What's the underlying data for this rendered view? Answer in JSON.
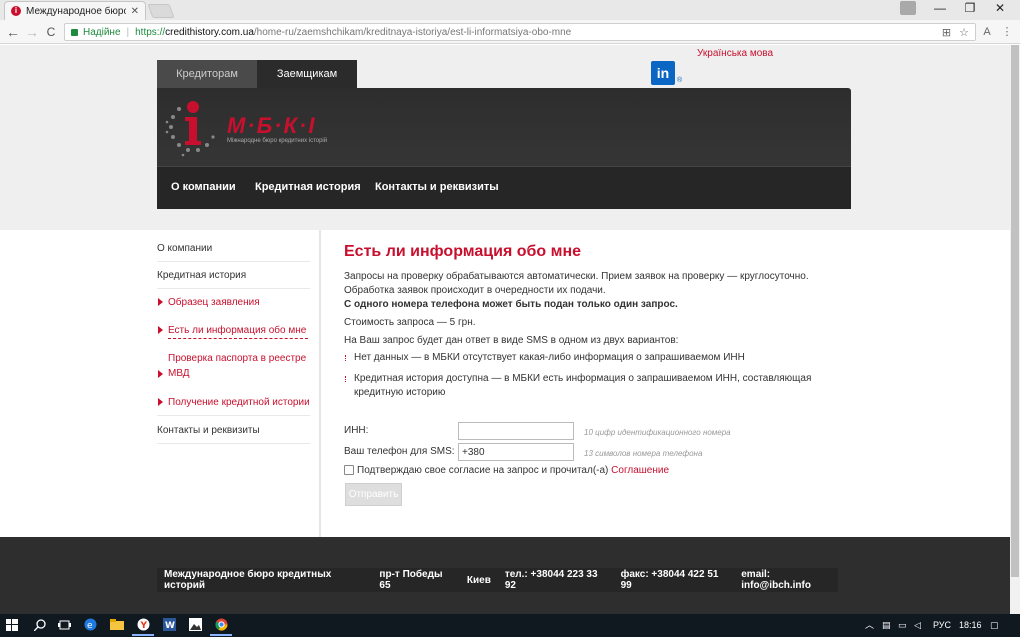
{
  "browser": {
    "tab_title": "Международное бюро",
    "tab_close": "✕",
    "secure_label": "Надійне",
    "url_proto": "https://",
    "url_host": "credithistory.com.ua",
    "url_path": "/home-ru/zaemshchikam/kreditnaya-istoriya/est-li-informatsiya-obo-mne",
    "back": "←",
    "forward": "→",
    "reload": "C",
    "min": "—",
    "max": "❐",
    "close": "✕",
    "translate_icon": "⊞",
    "star_icon": "☆",
    "ext_icon": "A",
    "menu_icon": "⋮"
  },
  "header": {
    "language_link": "Українська мова",
    "linkedin": "in",
    "linkedin_reg": "®",
    "tabs": [
      {
        "label": "Кредиторам"
      },
      {
        "label": "Заемщикам"
      }
    ],
    "logo_text": "М·Б·К·І",
    "logo_subtitle": "Міжнародне бюро кредитних історій",
    "menu": [
      {
        "label": "О компании"
      },
      {
        "label": "Кредитная история"
      },
      {
        "label": "Контакты и реквизиты"
      }
    ]
  },
  "sidebar": {
    "items": [
      {
        "label": "О компании"
      },
      {
        "label": "Кредитная история"
      },
      {
        "label": "Образец заявления"
      },
      {
        "label": "Есть ли информация обо мне"
      },
      {
        "label": "Проверка паспорта в реестре МВД"
      },
      {
        "label": "Получение кредитной истории"
      },
      {
        "label": "Контакты и реквизиты"
      }
    ]
  },
  "main": {
    "title": "Есть ли информация обо мне",
    "para1": "Запросы на проверку обрабатываются автоматически. Прием заявок на проверку — круглосуточно.",
    "para2": "Обработка заявок происходит в очередности их подачи.",
    "para3": "С одного номера телефона может быть подан только один запрос.",
    "para4": "Стоимость запроса — 5 грн.",
    "para5": "На Ваш запрос будет дан ответ в виде SMS в одном из двух вариантов:",
    "bullets": [
      "Нет данных — в МБКИ отсутствует какая-либо информация о запрашиваемом ИНН",
      "Кредитная история доступна — в МБКИ есть информация о запрашиваемом ИНН, составляющая кредитную историю"
    ],
    "form": {
      "inn_label": "ИНН:",
      "inn_value": "",
      "inn_hint": "10 цифр идентификационного номера",
      "phone_label": "Ваш телефон для SMS:",
      "phone_value": "+380",
      "phone_hint": "13 символов номера телефона",
      "consent_text": "Подтверждаю свое согласие на запрос и прочитал(-а) ",
      "consent_link": "Соглашение",
      "consent_checked": false,
      "submit_label": "Отправить"
    }
  },
  "footer": {
    "org": "Международное бюро кредитных историй",
    "address": "пр-т Победы 65",
    "city": "Киев",
    "phone": "тел.: +38044 223 33 92",
    "fax": "факс: +38044 422 51 99",
    "email": "email: info@ibch.info"
  },
  "taskbar": {
    "lang": "РУС",
    "time": "18:16",
    "icons": [
      "windows-icon",
      "search-icon",
      "task-view-icon",
      "edge-icon",
      "explorer-icon",
      "yandex-icon",
      "word-icon",
      "photos-icon",
      "chrome-icon"
    ]
  },
  "colors": {
    "accent": "#c8102e",
    "header_bg": "#2d2d2d",
    "secure": "#1e8a3e"
  }
}
